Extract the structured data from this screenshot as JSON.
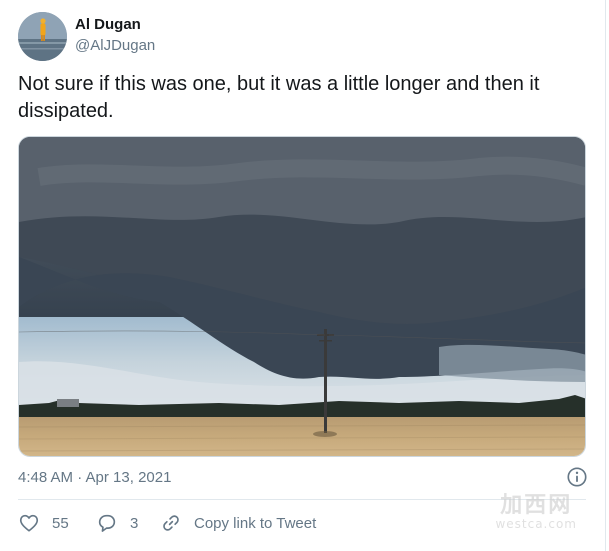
{
  "author": {
    "name": "Al Dugan",
    "handle": "@AlJDugan",
    "avatar_icon": "person-standing-in-water-avatar"
  },
  "tweet": {
    "text": "Not sure if this was one, but it was a little longer and then it dissipated.",
    "media_alt": "",
    "timestamp": "4:48 AM · Apr 13, 2021"
  },
  "actions": {
    "likes_count": "55",
    "replies_count": "3",
    "copy_link_label": "Copy link to Tweet",
    "like_icon": "heart-icon",
    "reply_icon": "speech-bubble-icon",
    "link_icon": "chain-link-icon",
    "info_icon": "info-icon"
  },
  "watermark": {
    "chinese": "加西网",
    "domain": "westca.com"
  },
  "colors": {
    "text_primary": "#14171a",
    "text_secondary": "#657786",
    "border": "#e1e8ed"
  }
}
